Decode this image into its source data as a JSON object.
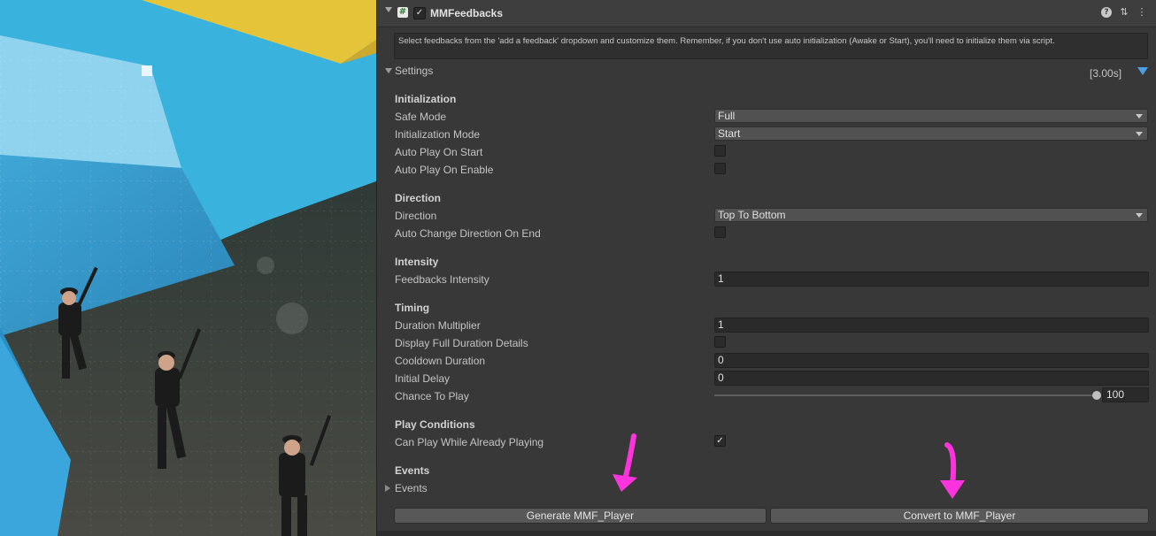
{
  "component": {
    "title": "MMFeedbacks",
    "enabled": true,
    "icons": [
      "help-icon",
      "presets-icon",
      "kebab-menu-icon"
    ]
  },
  "info_text": "Select feedbacks from the 'add a feedback' dropdown and customize them. Remember, if you don't use auto initialization (Awake or Start), you'll need to initialize them via script.",
  "settings": {
    "label": "Settings",
    "duration": "[3.00s]"
  },
  "sections": {
    "initialization": "Initialization",
    "direction": "Direction",
    "intensity": "Intensity",
    "timing": "Timing",
    "play_conditions": "Play Conditions",
    "events": "Events"
  },
  "fields": {
    "safe_mode": {
      "label": "Safe Mode",
      "value": "Full"
    },
    "initialization_mode": {
      "label": "Initialization Mode",
      "value": "Start"
    },
    "auto_play_on_start": {
      "label": "Auto Play On Start",
      "checked": false
    },
    "auto_play_on_enable": {
      "label": "Auto Play On Enable",
      "checked": false
    },
    "direction": {
      "label": "Direction",
      "value": "Top To Bottom"
    },
    "auto_change_direction": {
      "label": "Auto Change Direction On End",
      "checked": false
    },
    "feedbacks_intensity": {
      "label": "Feedbacks Intensity",
      "value": "1"
    },
    "duration_multiplier": {
      "label": "Duration Multiplier",
      "value": "1"
    },
    "display_full_duration": {
      "label": "Display Full Duration Details",
      "checked": false
    },
    "cooldown_duration": {
      "label": "Cooldown Duration",
      "value": "0"
    },
    "initial_delay": {
      "label": "Initial Delay",
      "value": "0"
    },
    "chance_to_play": {
      "label": "Chance To Play",
      "value": "100",
      "fraction": 1.0
    },
    "can_play_while_playing": {
      "label": "Can Play While Already Playing",
      "checked": true
    },
    "events_foldout": {
      "label": "Events"
    }
  },
  "buttons": {
    "generate": "Generate MMF_Player",
    "convert": "Convert to MMF_Player"
  },
  "glyphs": {
    "check": "✓",
    "help": "?",
    "presets": "⇅",
    "kebab": "⋮",
    "script": "#"
  },
  "colors": {
    "inspector_bg": "#383838",
    "accent_blue": "#4aa0e6",
    "annotation_magenta": "#ff33dd"
  }
}
